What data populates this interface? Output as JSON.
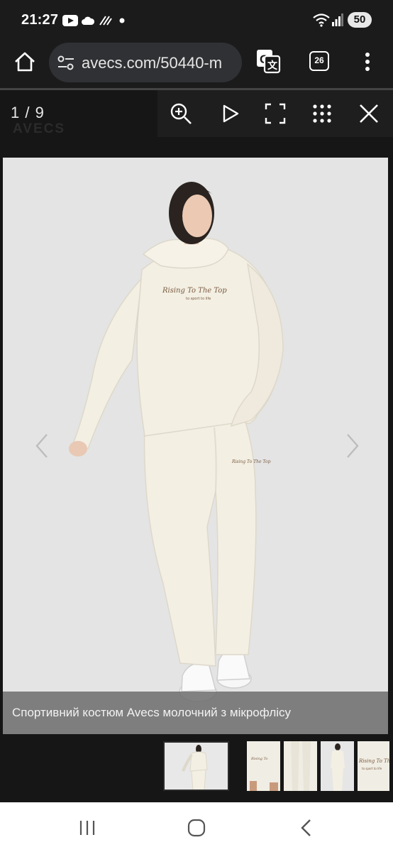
{
  "status_bar": {
    "time": "21:27",
    "battery": "50",
    "icons": [
      "youtube-icon",
      "cloud-icon",
      "signal-icon",
      "dot-icon",
      "wifi-icon",
      "cell-signal-icon",
      "battery-icon"
    ]
  },
  "browser": {
    "url": "avecs.com/50440-m",
    "tab_count": "26",
    "icons": [
      "home-icon",
      "site-info-icon",
      "translate-icon",
      "tabs-icon",
      "menu-icon"
    ]
  },
  "background": {
    "logo_text": "AVECS"
  },
  "gallery": {
    "counter": "1 / 9",
    "toolbar_icons": [
      "zoom-in-icon",
      "play-icon",
      "fullscreen-icon",
      "grid-icon",
      "close-icon"
    ],
    "caption": "Спортивний костюм Avecs молочний з мікрофлісу",
    "hoodie_print": "Rising To The Top",
    "hoodie_subprint": "to sport to life",
    "thumbnail_count": 5,
    "active_thumbnail": 1
  },
  "nav_bar": {
    "icons": [
      "recent-apps-icon",
      "home-nav-icon",
      "back-icon"
    ]
  },
  "colors": {
    "background": "#151515",
    "image_bg": "#e4e4e4",
    "garment": "#f3efe3",
    "caption_bg": "#6c6c6c"
  }
}
